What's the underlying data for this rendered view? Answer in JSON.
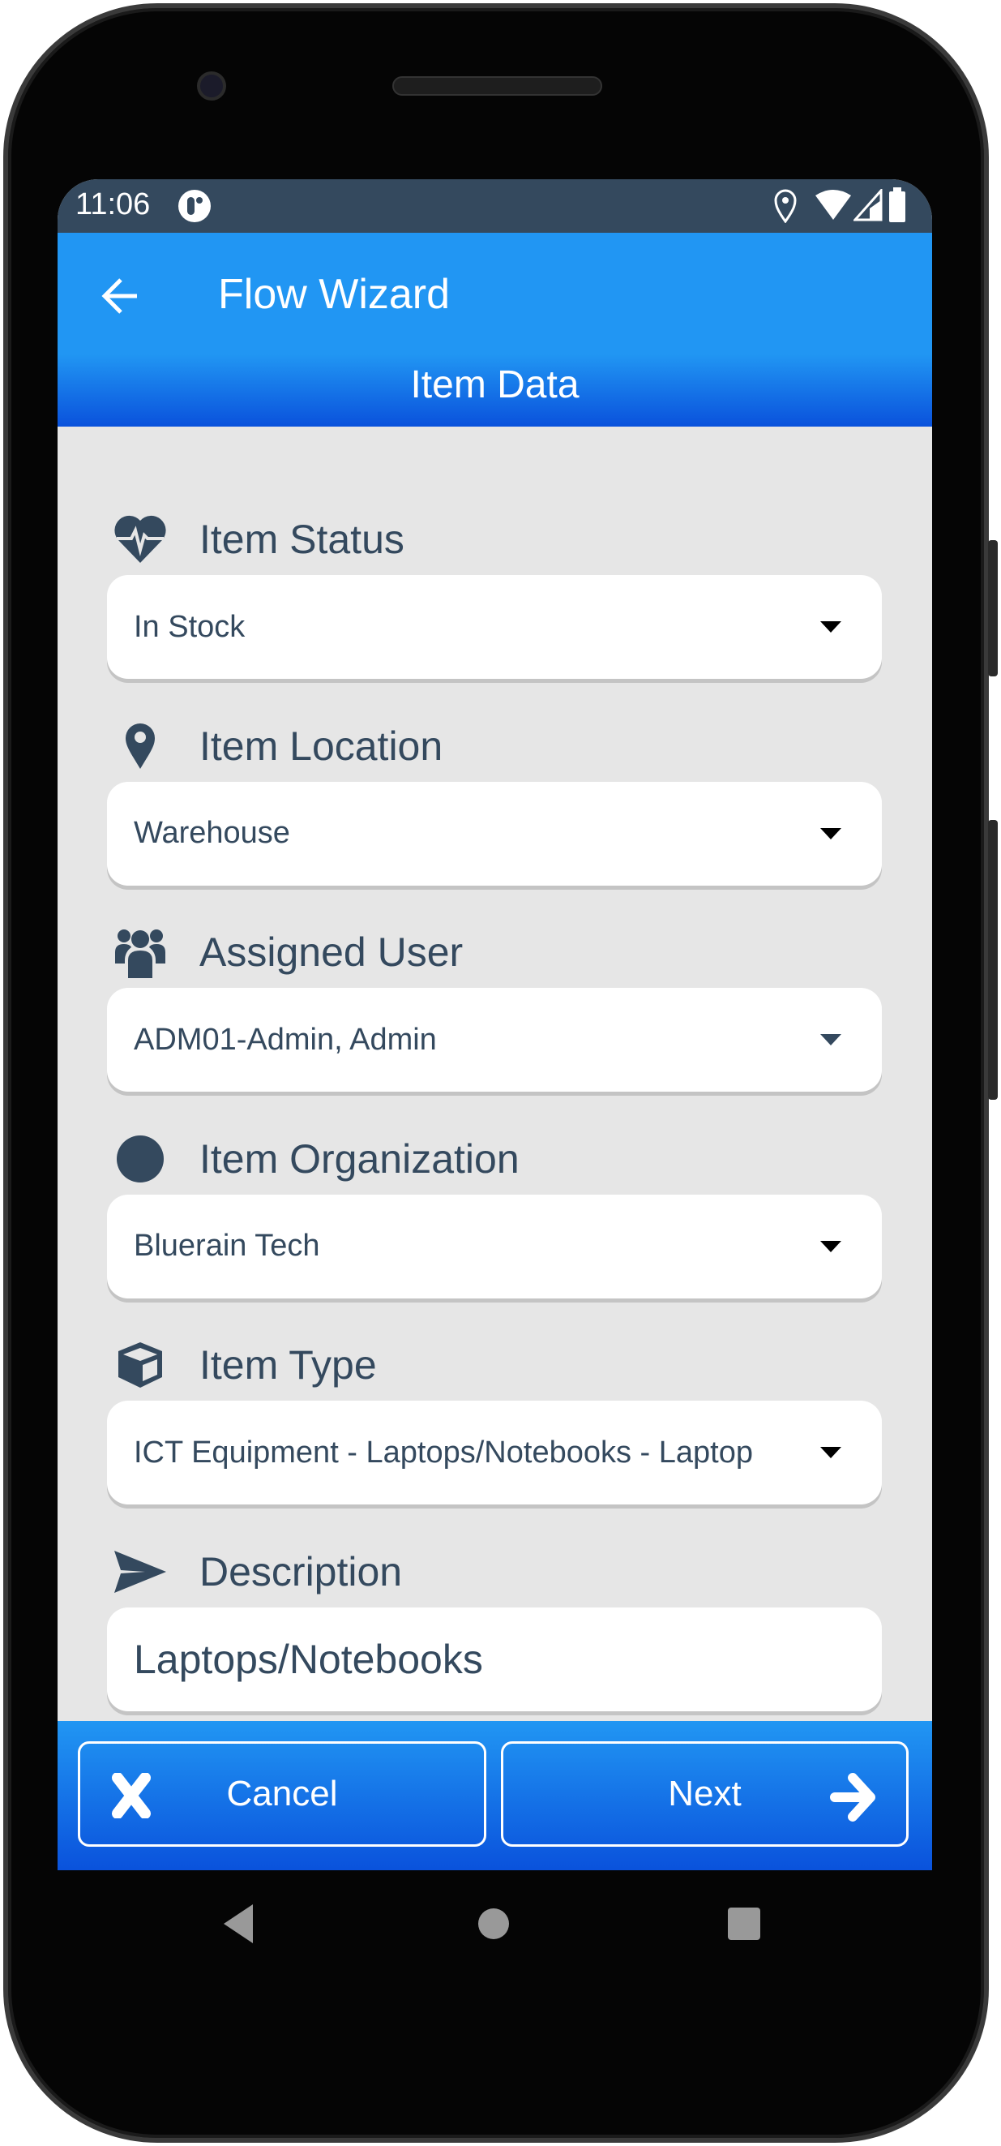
{
  "status_bar": {
    "time": "11:06"
  },
  "header": {
    "title": "Flow Wizard",
    "subtitle": "Item Data"
  },
  "fields": [
    {
      "label": "Item Status",
      "icon": "heartbeat-icon",
      "value": "In Stock",
      "type": "dropdown"
    },
    {
      "label": "Item Location",
      "icon": "map-marker-icon",
      "value": "Warehouse",
      "type": "dropdown"
    },
    {
      "label": "Assigned User",
      "icon": "users-icon",
      "value": "ADM01-Admin, Admin",
      "type": "dropdown"
    },
    {
      "label": "Item Organization",
      "icon": "circle-icon",
      "value": "Bluerain Tech",
      "type": "dropdown"
    },
    {
      "label": "Item Type",
      "icon": "cube-icon",
      "value": "ICT Equipment - Laptops/Notebooks - Laptop",
      "type": "dropdown"
    },
    {
      "label": "Description",
      "icon": "paper-plane-icon",
      "value": "Laptops/Notebooks",
      "type": "text"
    }
  ],
  "footer": {
    "cancel_label": "Cancel",
    "next_label": "Next"
  },
  "colors": {
    "primary": "#2196f3",
    "primary_dark": "#0a52dc",
    "status_bar": "#34495e",
    "text": "#34495e",
    "content_bg": "#e6e6e6"
  }
}
